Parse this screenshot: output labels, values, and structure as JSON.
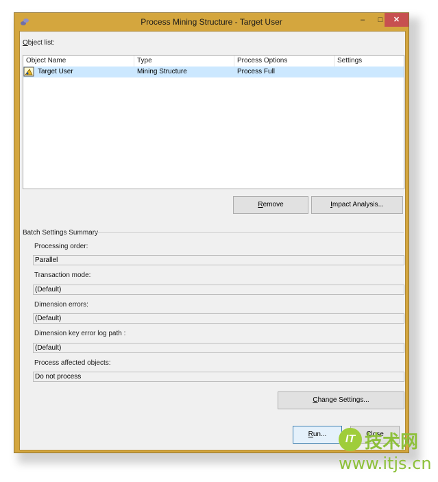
{
  "window": {
    "title": "Process Mining Structure - Target User",
    "minimize": "–",
    "maximize": "□",
    "close": "✕"
  },
  "object_list": {
    "label_prefix": "O",
    "label_rest": "bject list:",
    "columns": [
      "Object Name",
      "Type",
      "Process Options",
      "Settings"
    ],
    "rows": [
      {
        "name": "Target User",
        "type": "Mining Structure",
        "process_options": "Process Full",
        "settings": "",
        "icon": "mining-structure-icon"
      }
    ]
  },
  "buttons": {
    "remove_prefix": "R",
    "remove_rest": "emove",
    "impact_prefix": "I",
    "impact_rest": "mpact Analysis...",
    "change_prefix": "C",
    "change_rest": "hange Settings...",
    "run_prefix": "R",
    "run_rest": "un...",
    "close": "Close"
  },
  "batch": {
    "title": "Batch Settings Summary",
    "processing_order_label": "Processing order:",
    "processing_order_value": "Parallel",
    "transaction_mode_label": "Transaction mode:",
    "transaction_mode_value": "(Default)",
    "dimension_errors_label": "Dimension errors:",
    "dimension_errors_value": "(Default)",
    "key_error_log_label": "Dimension key error log path :",
    "key_error_log_value": "(Default)",
    "process_affected_label": "Process affected objects:",
    "process_affected_value": "Do not process"
  },
  "watermark": {
    "logo": "IT",
    "text": "技术网",
    "url": "www.itjs.cn"
  },
  "colors": {
    "frame": "#d4a63e",
    "selection": "#cce8ff",
    "close_button": "#c75050",
    "watermark": "#8dc03a"
  }
}
